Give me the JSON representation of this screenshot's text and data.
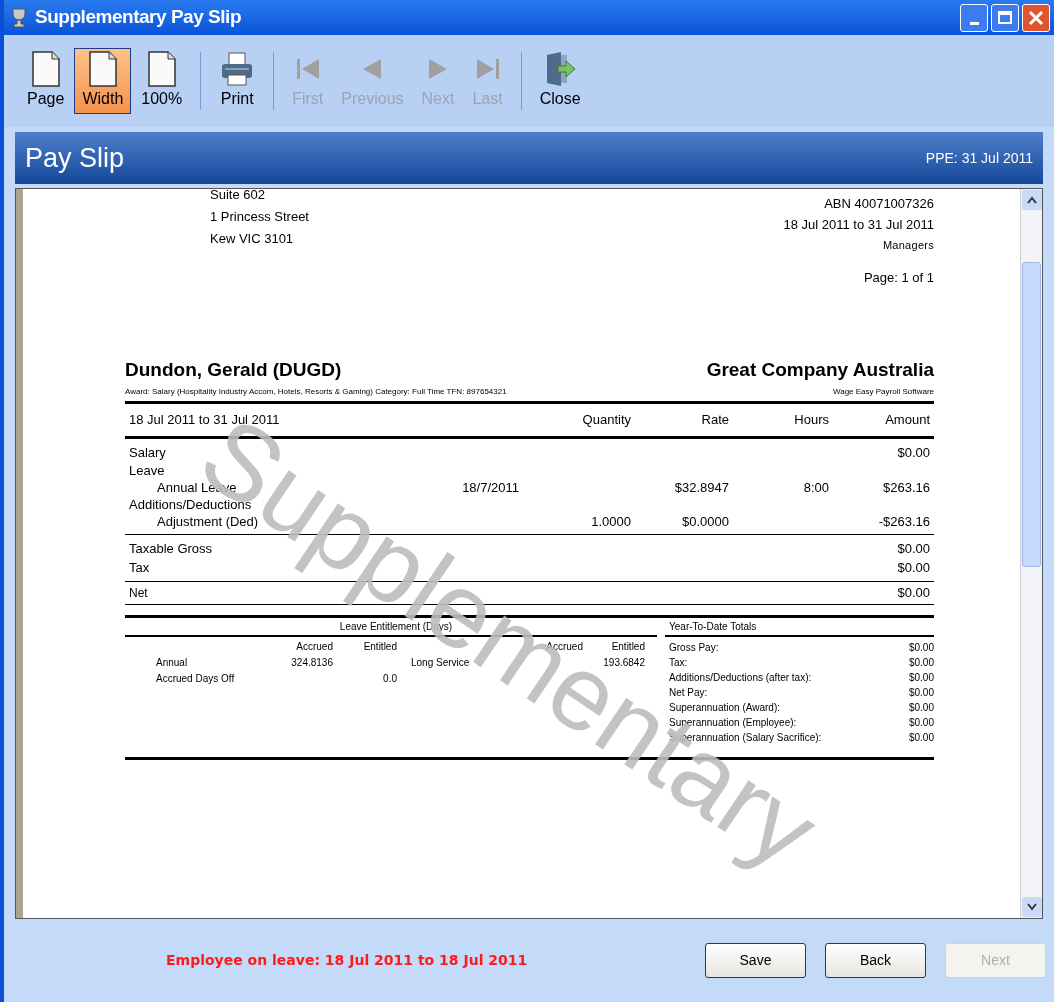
{
  "window": {
    "title": "Supplementary Pay Slip"
  },
  "toolbar": {
    "groups": [
      [
        {
          "label": "Page",
          "kind": "page",
          "selected": false,
          "disabled": false
        },
        {
          "label": "Width",
          "kind": "width",
          "selected": true,
          "disabled": false
        },
        {
          "label": "100%",
          "kind": "full",
          "selected": false,
          "disabled": false
        }
      ],
      [
        {
          "label": "Print",
          "kind": "print",
          "selected": false,
          "disabled": false
        }
      ],
      [
        {
          "label": "First",
          "kind": "first",
          "selected": false,
          "disabled": true
        },
        {
          "label": "Previous",
          "kind": "previous",
          "selected": false,
          "disabled": true
        },
        {
          "label": "Next",
          "kind": "next",
          "selected": false,
          "disabled": true
        },
        {
          "label": "Last",
          "kind": "last",
          "selected": false,
          "disabled": true
        }
      ],
      [
        {
          "label": "Close",
          "kind": "close",
          "selected": false,
          "disabled": false
        }
      ]
    ]
  },
  "header": {
    "title": "Pay Slip",
    "ppe": "PPE: 31 Jul 2011"
  },
  "document": {
    "watermark": "Supplementary",
    "address": [
      "Suite 602",
      "1 Princess Street",
      "Kew VIC 3101"
    ],
    "company_info": [
      "ABN 40071007326",
      "18 Jul 2011 to 31 Jul 2011",
      "Managers"
    ],
    "page": "Page: 1 of 1",
    "employee": "Dundon, Gerald (DUGD)",
    "company": "Great Company Australia",
    "award_line": "Award: Salary (Hospitality Industry Accom, Hotels, Resorts & Gaming)   Category: Full Time   TFN: 897654321",
    "software": "Wage Easy Payroll Software",
    "earnings": {
      "columns": [
        "18 Jul 2011 to 31 Jul 2011",
        "",
        "Quantity",
        "Rate",
        "Hours",
        "Amount"
      ],
      "rows": [
        {
          "kind": "item",
          "cells": [
            "Salary",
            "",
            "",
            "",
            "",
            "$0.00"
          ]
        },
        {
          "kind": "heading",
          "cells": [
            "Leave",
            "",
            "",
            "",
            "",
            ""
          ]
        },
        {
          "kind": "subitem",
          "cells": [
            "Annual Leave",
            "18/7/2011",
            "",
            "$32.8947",
            "8:00",
            "$263.16"
          ]
        },
        {
          "kind": "heading",
          "cells": [
            "Additions/Deductions",
            "",
            "",
            "",
            "",
            ""
          ]
        },
        {
          "kind": "subitem",
          "cells": [
            "Adjustment (Ded)",
            "",
            "1.0000",
            "$0.0000",
            "",
            "-$263.16"
          ]
        }
      ],
      "totals": [
        {
          "label": "Taxable Gross",
          "amount": "$0.00"
        },
        {
          "label": "Tax",
          "amount": "$0.00"
        }
      ],
      "net": {
        "label": "Net",
        "amount": "$0.00"
      }
    },
    "leave": {
      "title": "Leave Entitlement (Days)",
      "groups": [
        {
          "accrued_heading": "Accrued",
          "entitled_heading": "Entitled",
          "rows": [
            {
              "name": "Annual",
              "accrued": "324.8136",
              "entitled": ""
            },
            {
              "name": "Accrued Days Off",
              "accrued": "",
              "entitled": "0.0"
            }
          ]
        },
        {
          "accrued_heading": "Accrued",
          "entitled_heading": "Entitled",
          "rows": [
            {
              "name": "Long Service",
              "accrued": "",
              "entitled": "193.6842"
            }
          ]
        }
      ]
    },
    "ytd": {
      "title": "Year-To-Date Totals",
      "rows": [
        {
          "label": "Gross Pay:",
          "value": "$0.00"
        },
        {
          "label": "Tax:",
          "value": "$0.00"
        },
        {
          "label": "Additions/Deductions (after tax):",
          "value": "$0.00"
        },
        {
          "label": "Net Pay:",
          "value": "$0.00"
        },
        {
          "label": "Superannuation (Award):",
          "value": "$0.00"
        },
        {
          "label": "Superannuation (Employee):",
          "value": "$0.00"
        },
        {
          "label": "Superannuation (Salary Sacrifice):",
          "value": "$0.00"
        }
      ]
    }
  },
  "footer": {
    "message": "Employee on leave: 18 Jul 2011 to 18 Jul 2011",
    "buttons": [
      {
        "label": "Save",
        "disabled": false
      },
      {
        "label": "Back",
        "disabled": false
      },
      {
        "label": "Next",
        "disabled": true
      }
    ]
  }
}
